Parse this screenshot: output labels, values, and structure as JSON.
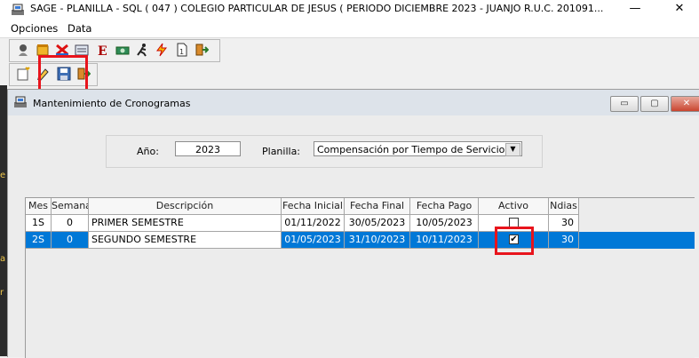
{
  "window": {
    "title": "SAGE - PLANILLA - SQL  ( 047 ) COLEGIO PARTICULAR DE JESUS ( PERIODO DICIEMBRE 2023 - JUANJO  R.U.C. 201091...",
    "minimize": "—",
    "close": "✕"
  },
  "menu": [
    "Opciones",
    "Data"
  ],
  "toolbar1_icons": [
    "person-icon",
    "box-icon",
    "delete-icon",
    "card-icon",
    "e-icon",
    "money-icon",
    "runner-icon",
    "lightning-icon",
    "document-icon",
    "exit-icon"
  ],
  "toolbar2_icons": [
    "new-icon",
    "edit-icon",
    "save-icon",
    "exit-icon"
  ],
  "left_strip": [
    "e",
    "a",
    "r"
  ],
  "child": {
    "title": "Mantenimiento de Cronogramas",
    "buttons": {
      "minimize": "▭",
      "restore": "▢",
      "close": "✕"
    }
  },
  "filter": {
    "year_label": "Año:",
    "year_value": "2023",
    "planilla_label": "Planilla:",
    "planilla_value": "Compensación por Tiempo de Servicio",
    "dropdown_glyph": "▼"
  },
  "grid": {
    "headers": [
      "Mes",
      "Semana",
      "Descripción",
      "Fecha Inicial",
      "Fecha Final",
      "Fecha Pago",
      "Activo",
      "Ndias"
    ],
    "rows": [
      {
        "mes": "1S",
        "semana": "0",
        "descripcion": "PRIMER SEMESTRE",
        "fecha_inicial": "01/11/2022",
        "fecha_final": "30/05/2023",
        "fecha_pago": "10/05/2023",
        "activo": false,
        "ndias": "30",
        "selected": false
      },
      {
        "mes": "2S",
        "semana": "0",
        "descripcion": "SEGUNDO SEMESTRE",
        "fecha_inicial": "01/05/2023",
        "fecha_final": "31/10/2023",
        "fecha_pago": "10/11/2023",
        "activo": true,
        "ndias": "30",
        "selected": true
      }
    ]
  },
  "colors": {
    "selection": "#0078d7",
    "highlight_box": "#e8141c"
  }
}
